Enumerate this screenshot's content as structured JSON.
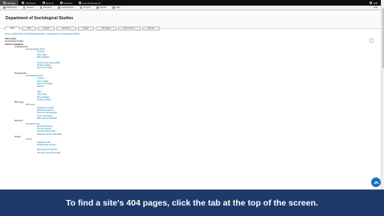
{
  "admin_bar": {
    "items": [
      "Manage",
      "Shortcuts",
      "Search",
      "Account",
      "Live environment"
    ],
    "right_label": "Edit"
  },
  "toolbar": {
    "items": [
      "Dashboard",
      "Content",
      "Structure",
      "Configuration",
      "Groups",
      "People",
      "Help"
    ],
    "right_label": "Edit"
  },
  "page": {
    "title": "Department of Sociological Studies",
    "breadcrumb": "Home » Department of Sociological Studies » Department of Sociological Studies"
  },
  "tabs": [
    "View",
    "Edit",
    "Delete",
    "Revisions",
    "Pages",
    "404 pages",
    "Site structure",
    "Rebuild"
  ],
  "meta": {
    "label1": "Short name",
    "value1": "Sociological Studies",
    "label2": "Section navigation"
  },
  "tree": {
    "undergraduate": "Undergraduate",
    "undergraduate_sub": "Undergraduate Study",
    "ug_links": [
      "Courses",
      "Open Days",
      "Why Sheffield"
    ],
    "ug_links2": [
      "Careers and employability",
      "Student profiles",
      "Fees and funding"
    ],
    "postgraduate": "Postgraduate",
    "pg_sub": "Postgraduate study",
    "pg_links": [
      "Courses",
      "How to apply",
      "Fees and funding",
      "Careers"
    ],
    "pg_links2": [
      "CPD",
      "Open days",
      "Why Sheffield",
      "Student profiles"
    ],
    "phd": "PhD study",
    "phd_sub": "PhD study",
    "phd_links": [
      "Applying for a PhD",
      "Research students",
      "Fees and scholarships",
      "Find a supervisor",
      "PhD study at Sheffield"
    ],
    "research": "Research",
    "research_sub": "Research home",
    "research_links": [
      "Research themes",
      "Current projects",
      "Impacts and benefits",
      "Research ethics information"
    ],
    "people": "People",
    "people_sub": "People",
    "people_links": [
      "Academic staff",
      "Professional services"
    ],
    "people_links2": [
      "PhD research students",
      "Honorary and visiting staff"
    ]
  },
  "caption": "To find a site's 404 pages, click the tab at the top of the screen.",
  "colors": {
    "link": "#0b6ea8",
    "caption_bg": "#1d3a6b",
    "admin_bg": "#0f0f0f"
  }
}
